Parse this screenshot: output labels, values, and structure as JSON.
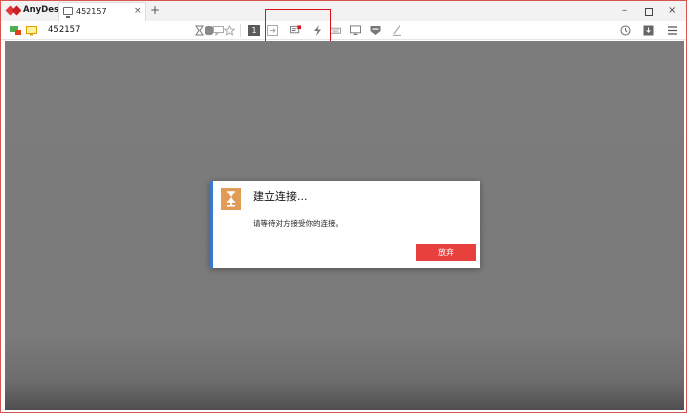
{
  "app": {
    "name": "AnyDesk"
  },
  "tab": {
    "label": "452157",
    "close": "×",
    "new_tab": "+"
  },
  "window_controls": {
    "minimize": "–",
    "close": "×"
  },
  "toolbar": {
    "address": "452157",
    "icons": [
      "remote-status-icon",
      "monitor-icon",
      "hourglass-icon",
      "database-icon",
      "chat-icon",
      "star-icon",
      "display-1-icon",
      "input-icon",
      "chat-request-icon",
      "actions-icon",
      "keyboard-icon",
      "display-icon",
      "privacy-icon",
      "pen-icon",
      "history-icon",
      "download-icon",
      "menu-icon"
    ],
    "display_number": "1"
  },
  "dialog": {
    "title": "建立连接...",
    "message": "请等待对方接受你的连接。",
    "abort_label": "放弃"
  },
  "colors": {
    "accent_red": "#e8403c",
    "highlight_red": "#e0101a",
    "dialog_left_bar": "#3a78c9",
    "hourglass_bg": "#e29a57",
    "remote_bg": "#7c7c7c"
  }
}
